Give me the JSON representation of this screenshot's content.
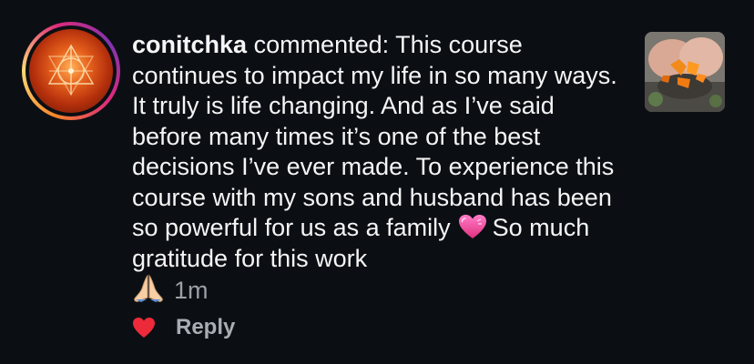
{
  "comment": {
    "username": "conitchka",
    "verb": "commented:",
    "text": "This course continues to impact my life in so many ways.  It truly is life changing.  And as I’ve said before many times it’s one of  the best decisions I’ve ever made.  To experience this course with my sons and husband has been so powerful for us as a family",
    "text_after_heart": "So much gratitude for this work",
    "emoji_1": "heart-emoji",
    "emoji_2": "folded-hands-emoji",
    "timestamp": "1m"
  },
  "actions": {
    "like_icon": "heart-icon",
    "like_color": "#ed2a3a",
    "reply_label": "Reply"
  },
  "colors": {
    "background": "#0b0f14",
    "text": "#f5f5f5",
    "muted": "#9aa0a6"
  }
}
